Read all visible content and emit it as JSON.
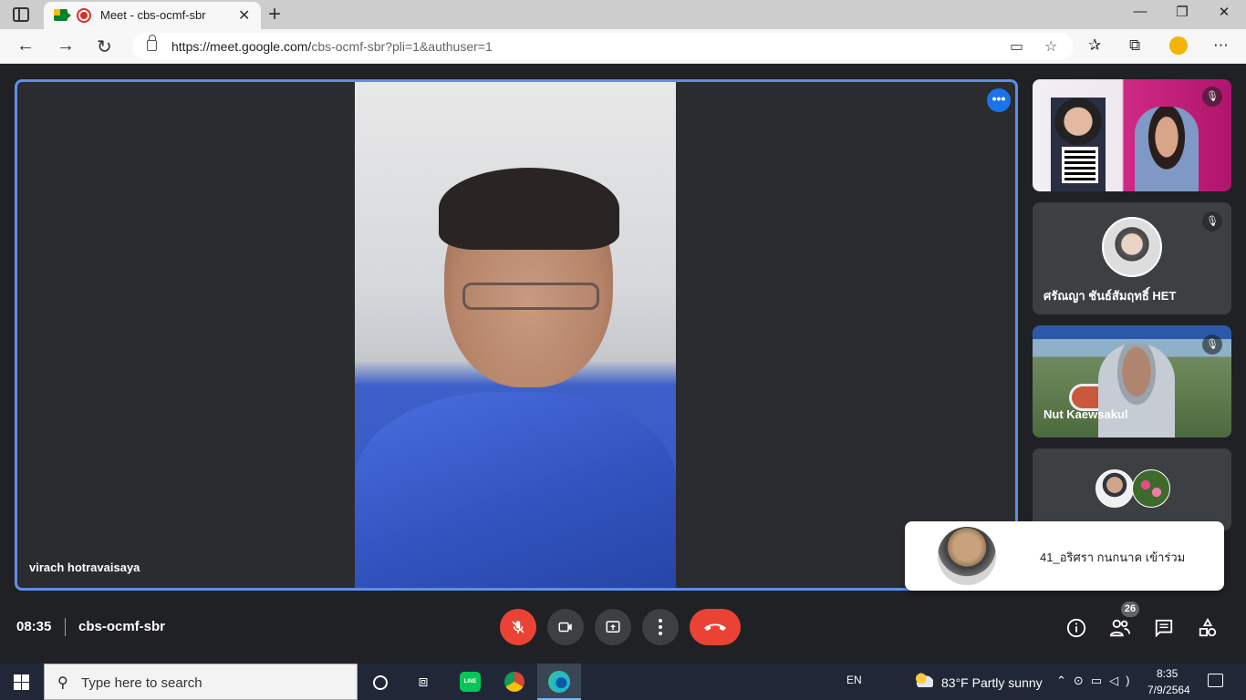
{
  "browser": {
    "tab_title": "Meet - cbs-ocmf-sbr",
    "tab_close": "✕",
    "new_tab": "+",
    "url_host": "https://meet.google.com/",
    "url_path": "cbs-ocmf-sbr?pli=1&authuser=1",
    "window_controls": {
      "minimize": "—",
      "restore": "❐",
      "close": "✕"
    },
    "nav": {
      "back": "←",
      "forward": "→",
      "reload": "↻"
    }
  },
  "main_tile": {
    "participant_name": "virach hotravaisaya",
    "more_label": "•••"
  },
  "side_tiles": {
    "tile2_name": "ศรัณญา ชันธ์สัมฤทธิ์ HET",
    "tile3_name": "Nut Kaewsakul",
    "mute_label": "🎙"
  },
  "notification": {
    "text": "41_อริศรา กนกนาค เข้าร่วม"
  },
  "bottom_bar": {
    "time": "08:35",
    "meeting_code": "cbs-ocmf-sbr",
    "participant_count": "26"
  },
  "taskbar": {
    "search_placeholder": "Type here to search",
    "language": "EN",
    "weather": "83°F  Partly sunny",
    "time": "8:35",
    "date": "7/9/2564"
  },
  "colors": {
    "accent_blue": "#5f8ee9",
    "danger_red": "#ea4335",
    "meet_bg": "#202124"
  }
}
